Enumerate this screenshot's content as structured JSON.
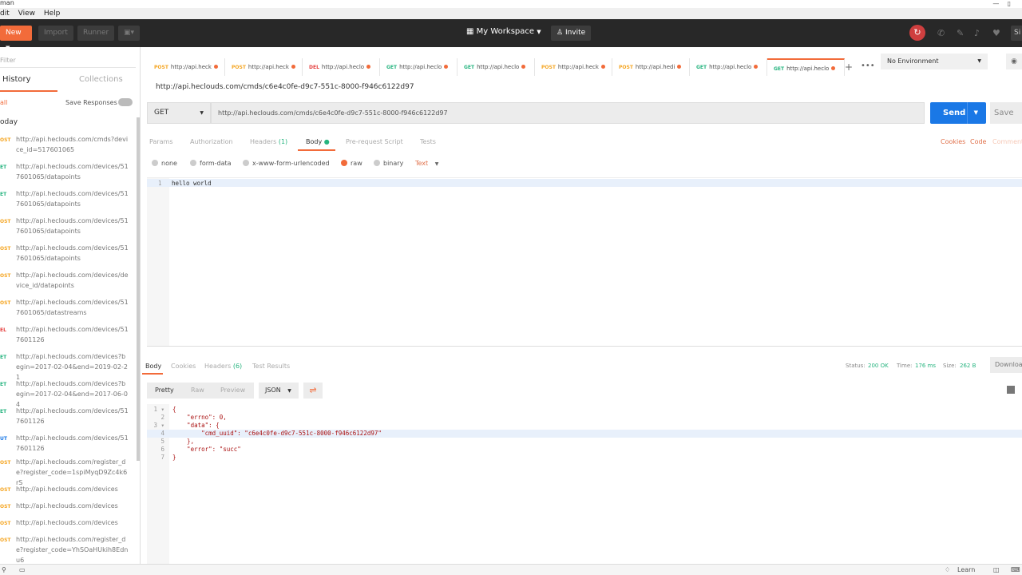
{
  "window": {
    "title": "man",
    "menu": [
      "dit",
      "View",
      "Help"
    ]
  },
  "header": {
    "new_label": "New",
    "import_label": "Import",
    "runner_label": "Runner",
    "workspace": "My Workspace",
    "invite": "Invite",
    "sign_in": "Si"
  },
  "sidebar": {
    "filter_placeholder": "Filter",
    "tabs": [
      "History",
      "Collections"
    ],
    "all_label": "all",
    "save_responses": "Save Responses",
    "group": "oday",
    "items": [
      {
        "method": "OST",
        "color": "#f5a623",
        "url": "http://api.heclouds.com/cmds?device_id=517601065"
      },
      {
        "method": "ET",
        "color": "#26b47f",
        "url": "http://api.heclouds.com/devices/517601065/datapoints"
      },
      {
        "method": "ET",
        "color": "#26b47f",
        "url": "http://api.heclouds.com/devices/517601065/datapoints"
      },
      {
        "method": "OST",
        "color": "#f5a623",
        "url": "http://api.heclouds.com/devices/517601065/datapoints"
      },
      {
        "method": "OST",
        "color": "#f5a623",
        "url": "http://api.heclouds.com/devices/517601065/datapoints"
      },
      {
        "method": "OST",
        "color": "#f5a623",
        "url": "http://api.heclouds.com/devices/device_id/datapoints"
      },
      {
        "method": "OST",
        "color": "#f5a623",
        "url": "http://api.heclouds.com/devices/517601065/datastreams"
      },
      {
        "method": "EL",
        "color": "#e5403f",
        "url": "http://api.heclouds.com/devices/517601126"
      },
      {
        "method": "ET",
        "color": "#26b47f",
        "url": "http://api.heclouds.com/devices?begin=2017-02-04&end=2019-02-21"
      },
      {
        "method": "ET",
        "color": "#26b47f",
        "url": "http://api.heclouds.com/devices?begin=2017-02-04&end=2017-06-04"
      },
      {
        "method": "ET",
        "color": "#26b47f",
        "url": "http://api.heclouds.com/devices/517601126"
      },
      {
        "method": "UT",
        "color": "#1a78e6",
        "url": "http://api.heclouds.com/devices/517601126"
      },
      {
        "method": "OST",
        "color": "#f5a623",
        "url": "http://api.heclouds.com/register_de?register_code=1spiMyqD9Zc4k6rS"
      },
      {
        "method": "OST",
        "color": "#f5a623",
        "url": "http://api.heclouds.com/devices"
      },
      {
        "method": "OST",
        "color": "#f5a623",
        "url": "http://api.heclouds.com/devices"
      },
      {
        "method": "OST",
        "color": "#f5a623",
        "url": "http://api.heclouds.com/devices"
      },
      {
        "method": "OST",
        "color": "#f5a623",
        "url": "http://api.heclouds.com/register_de?register_code=YhSOaHUkih8Ednu6"
      }
    ]
  },
  "tabs": [
    {
      "method": "POST",
      "color": "#f5a623",
      "url": "http://api.heck"
    },
    {
      "method": "POST",
      "color": "#f5a623",
      "url": "http://api.heck"
    },
    {
      "method": "DEL",
      "color": "#e5403f",
      "url": "http://api.heclo"
    },
    {
      "method": "GET",
      "color": "#26b47f",
      "url": "http://api.heclo"
    },
    {
      "method": "GET",
      "color": "#26b47f",
      "url": "http://api.heclo"
    },
    {
      "method": "POST",
      "color": "#f5a623",
      "url": "http://api.heck"
    },
    {
      "method": "POST",
      "color": "#f5a623",
      "url": "http://api.hedi"
    },
    {
      "method": "GET",
      "color": "#26b47f",
      "url": "http://api.heclo"
    },
    {
      "method": "GET",
      "color": "#26b47f",
      "url": "http://api.heclo"
    }
  ],
  "environment": "No Environment",
  "request": {
    "title": "http://api.heclouds.com/cmds/c6e4c0fe-d9c7-551c-8000-f946c6122d97",
    "method": "GET",
    "url": "http://api.heclouds.com/cmds/c6e4c0fe-d9c7-551c-8000-f946c6122d97",
    "send": "Send",
    "save": "Save",
    "tabs": {
      "params": "Params",
      "authorization": "Authorization",
      "headers": "Headers",
      "headers_count": "(1)",
      "body": "Body",
      "prerequest": "Pre-request Script",
      "tests": "Tests"
    },
    "links": {
      "cookies": "Cookies",
      "code": "Code",
      "comments": "Comments"
    },
    "body_modes": [
      "none",
      "form-data",
      "x-www-form-urlencoded",
      "raw",
      "binary"
    ],
    "selected_mode": "raw",
    "raw_type": "Text",
    "body_line_no": "1",
    "body_text": "hello world"
  },
  "response": {
    "tabs": {
      "body": "Body",
      "cookies": "Cookies",
      "headers": "Headers",
      "headers_count": "(6)",
      "tests": "Test Results"
    },
    "status_label": "Status:",
    "status": "200 OK",
    "time_label": "Time:",
    "time": "176 ms",
    "size_label": "Size:",
    "size": "262 B",
    "download": "Download",
    "views": [
      "Pretty",
      "Raw",
      "Preview"
    ],
    "format": "JSON",
    "lines": [
      "{",
      "    \"errno\": 0,",
      "    \"data\": {",
      "        \"cmd_uuid\": \"c6e4c0fe-d9c7-551c-8000-f946c6122d97\"",
      "    },",
      "    \"error\": \"succ\"",
      "}"
    ]
  },
  "statusbar": {
    "learn": "Learn"
  },
  "colors": {
    "accent": "#f26b3a",
    "send": "#1a78e6",
    "success": "#26b47f"
  }
}
